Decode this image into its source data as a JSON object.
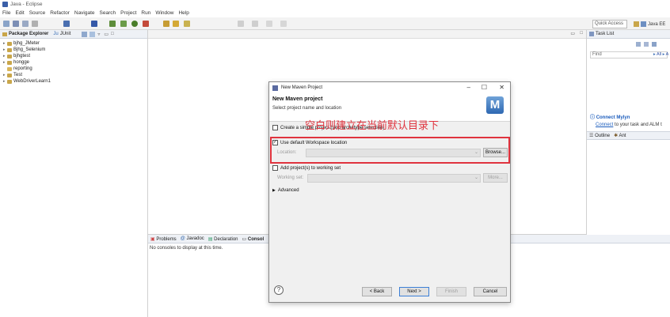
{
  "window": {
    "title": "Java - Eclipse"
  },
  "menu": [
    "File",
    "Edit",
    "Source",
    "Refactor",
    "Navigate",
    "Search",
    "Project",
    "Run",
    "Window",
    "Help"
  ],
  "toolbar": {
    "quick_access": "Quick Access",
    "perspective": "Java EE"
  },
  "left_panel": {
    "tabs": [
      {
        "label": "Package Explorer"
      },
      {
        "label": "JUnit"
      }
    ],
    "projects": [
      "bjhg_JMeter",
      "Bjhg_Selenium",
      "bjhgtest",
      "hongge",
      "reporting",
      "Test",
      "WebDriverLearn1"
    ]
  },
  "right_panel": {
    "task_tab": "Task List",
    "find_placeholder": "Find",
    "find_all": "All",
    "activate": "A",
    "mylyn_heading": "Connect Mylyn",
    "mylyn_link": "Connect",
    "mylyn_desc": "to your task and ALM t",
    "outline_tab": "Outline",
    "ant_tab": "Ant"
  },
  "console": {
    "tabs": [
      "Problems",
      "Javadoc",
      "Declaration",
      "Consol"
    ],
    "message": "No consoles to display at this time."
  },
  "dialog": {
    "title": "New Maven Project",
    "heading": "New Maven project",
    "subtitle": "Select project name and location",
    "simple_project": "Create a simple project (skip archetype selection)",
    "use_default": "Use default Workspace location",
    "location_label": "Location:",
    "browse": "Browse...",
    "add_working_set": "Add project(s) to working set",
    "working_set_label": "Working set:",
    "more": "More...",
    "advanced": "Advanced",
    "help": "?",
    "back": "< Back",
    "next": "Next >",
    "finish": "Finish",
    "cancel": "Cancel",
    "logo_letter": "M"
  },
  "annotation": "空白则建立在当前默认目录下",
  "colors": {
    "annotation": "#e0333e",
    "link": "#1c5dbd"
  }
}
